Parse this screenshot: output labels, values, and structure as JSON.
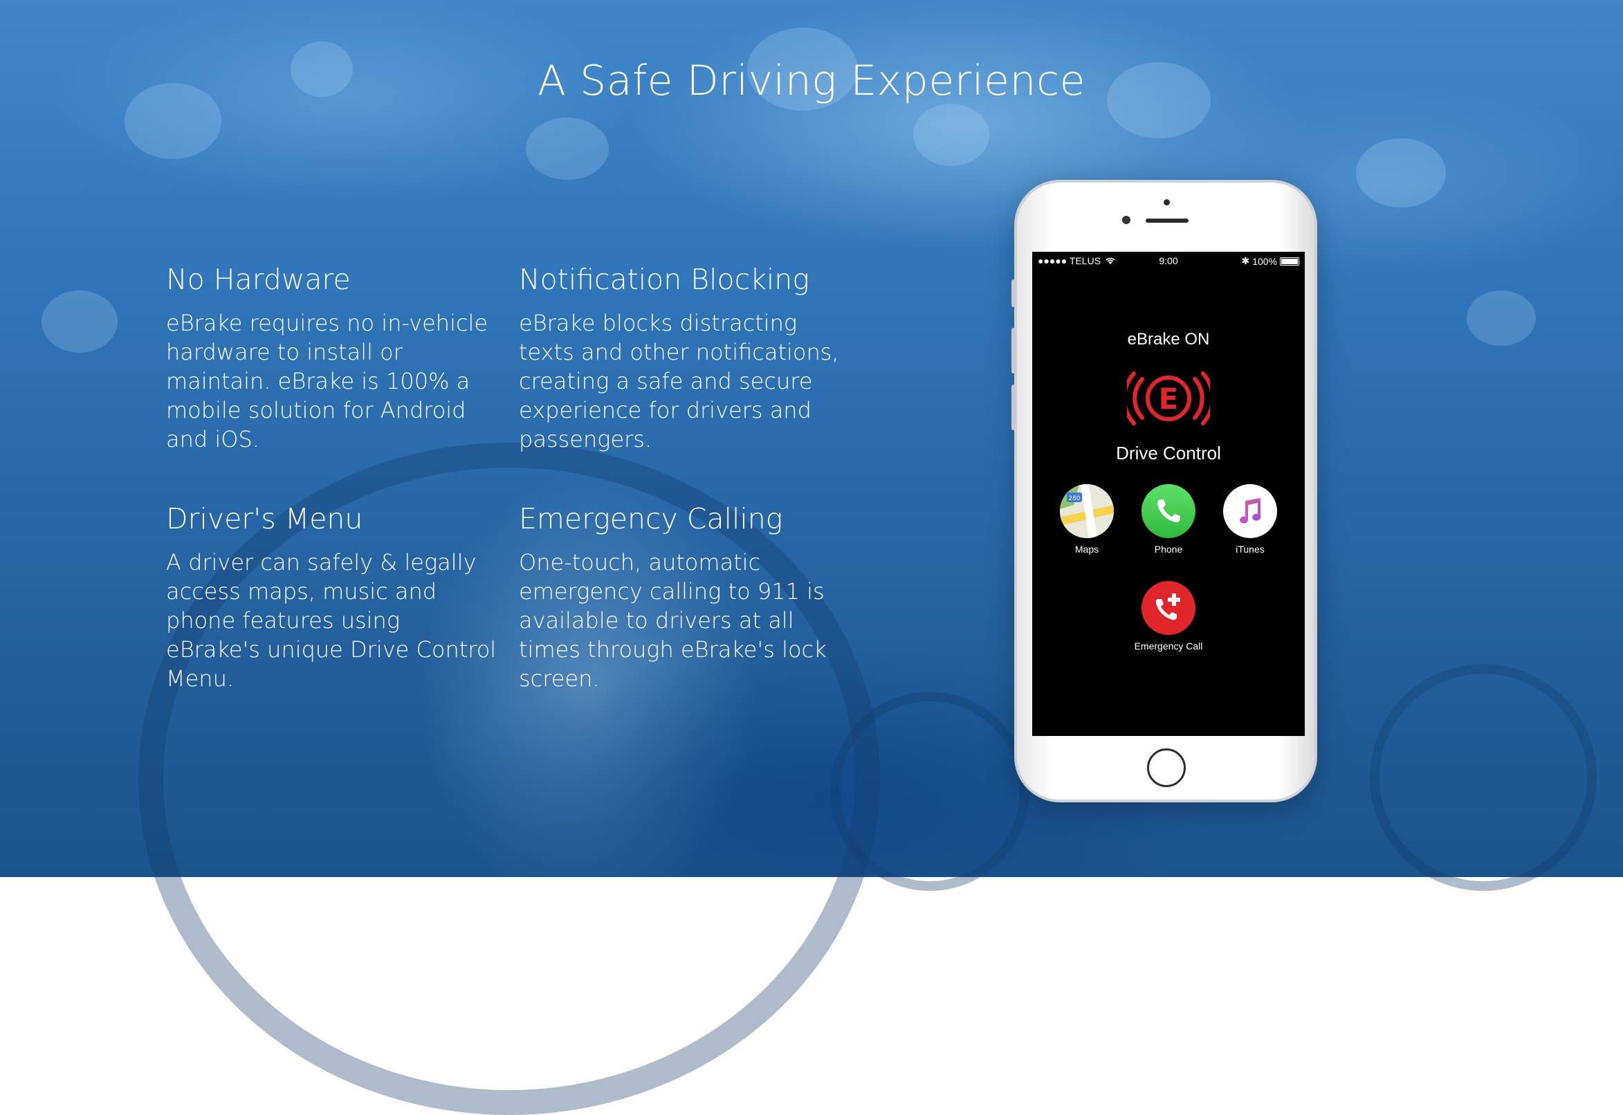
{
  "page": {
    "title": "A Safe Driving Experience",
    "accent_color": "#3a7fc2"
  },
  "features": [
    {
      "heading": "No Hardware",
      "text": "eBrake requires no in-vehicle hardware to install or maintain. eBrake is 100% a mobile solution for Android and iOS."
    },
    {
      "heading": "Notification Blocking",
      "text": "eBrake blocks distracting texts and other notifications, creating a safe and secure experience for drivers and passengers."
    },
    {
      "heading": "Driver's Menu",
      "text": "A driver can safely & legally access maps, music and phone features using eBrake's unique Drive Control Menu."
    },
    {
      "heading": "Emergency Calling",
      "text": "One-touch, automatic emergency calling to 911 is available to drivers at all times through eBrake's lock screen."
    }
  ],
  "phone": {
    "status_bar": {
      "carrier": "●●●●● TELUS",
      "time": "9:00",
      "battery": "100%"
    },
    "status_text": "eBrake ON",
    "logo_letter": "E",
    "logo_color": "#e0262b",
    "menu_title": "Drive Control",
    "apps": [
      {
        "label": "Maps",
        "icon": "maps-icon",
        "badge": "280"
      },
      {
        "label": "Phone",
        "icon": "phone-icon"
      },
      {
        "label": "iTunes",
        "icon": "music-icon"
      }
    ],
    "emergency": {
      "label": "Emergency Call",
      "icon": "emergency-call-icon"
    }
  }
}
